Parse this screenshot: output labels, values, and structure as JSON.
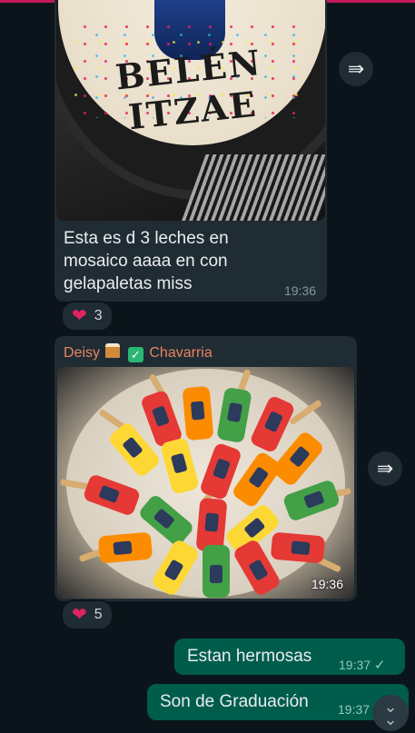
{
  "messages": [
    {
      "text": "Esta es d 3 leches en mosaico aaaa en con gelapaletas miss",
      "time": "19:36",
      "image_text": "BELÉN ITZAE",
      "reaction": {
        "emoji": "heart",
        "count": "3"
      }
    },
    {
      "sender": {
        "first": "Deisy",
        "last": "Chavarria"
      },
      "time": "19:36",
      "reaction": {
        "emoji": "heart",
        "count": "5"
      }
    }
  ],
  "outgoing": [
    {
      "text": "Estan hermosas",
      "time": "19:37",
      "tick": "✓"
    },
    {
      "text": "Son de Graduación",
      "time": "19:37"
    }
  ],
  "icons": {
    "forward": "forward-icon",
    "scroll_down": "double-chevron-down-icon",
    "reaction": "heart-icon"
  },
  "colors": {
    "background": "#0b141a",
    "incoming_bubble": "#202c33",
    "outgoing_bubble": "#005c4b",
    "sender_name": "#e8845f"
  }
}
